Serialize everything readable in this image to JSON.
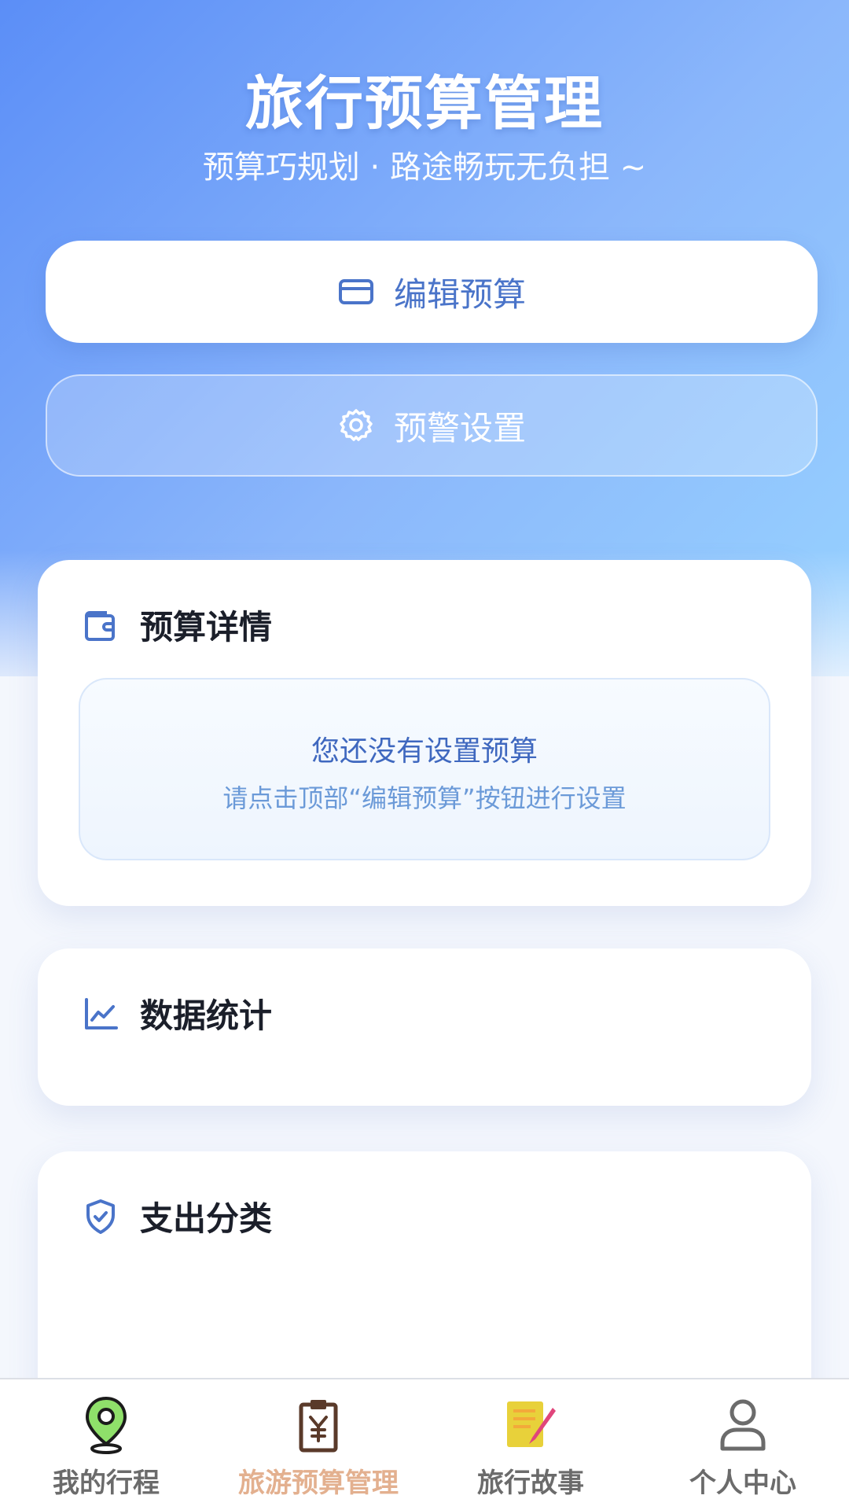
{
  "header": {
    "title": "旅行预算管理",
    "subtitle": "预算巧规划 · 路途畅玩无负担 ~"
  },
  "actions": {
    "edit_label": "编辑预算",
    "alert_label": "预警设置"
  },
  "budget_card": {
    "title": "预算详情",
    "empty_title": "您还没有设置预算",
    "empty_hint": "请点击顶部“编辑预算”按钮进行设置"
  },
  "stats_card": {
    "title": "数据统计"
  },
  "category_card": {
    "title": "支出分类"
  },
  "tabbar": {
    "items": [
      {
        "label": "我的行程",
        "icon": "map-pin-icon"
      },
      {
        "label": "旅游预算管理",
        "icon": "budget-clipboard-icon",
        "active": true
      },
      {
        "label": "旅行故事",
        "icon": "notebook-pen-icon"
      },
      {
        "label": "个人中心",
        "icon": "user-icon"
      }
    ]
  },
  "colors": {
    "accent": "#5b8ef7",
    "primary_text": "#4a74c9",
    "active_tab": "#e3b08f",
    "inactive_tab": "#6b6b6b"
  }
}
